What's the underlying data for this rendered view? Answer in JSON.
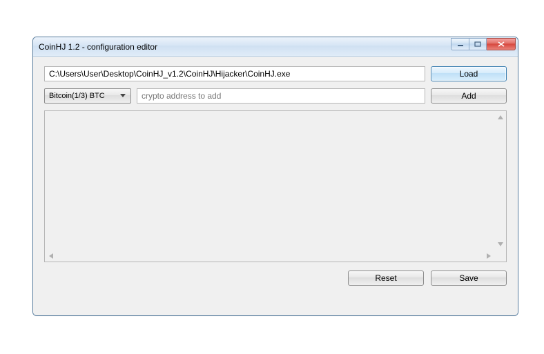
{
  "window": {
    "title": "CoinHJ 1.2 - configuration editor"
  },
  "path": {
    "value": "C:\\Users\\User\\Desktop\\CoinHJ_v1.2\\CoinHJ\\Hijacker\\CoinHJ.exe"
  },
  "buttons": {
    "load": "Load",
    "add": "Add",
    "reset": "Reset",
    "save": "Save"
  },
  "crypto_select": {
    "selected": "Bitcoin(1/3) BTC"
  },
  "address_input": {
    "placeholder": "crypto address to add",
    "value": ""
  }
}
